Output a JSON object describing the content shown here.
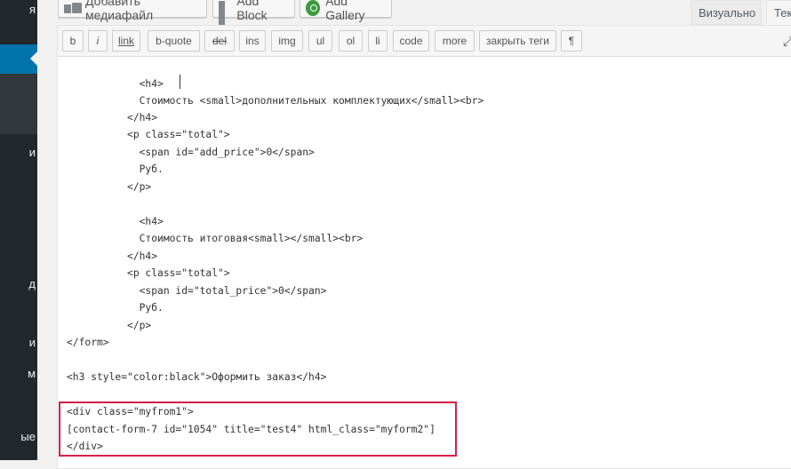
{
  "sidebar": {
    "fragments": [
      "я",
      "и",
      "д",
      "и",
      "м",
      "ые"
    ]
  },
  "media_buttons": {
    "add_media": "Добавить медиафайл",
    "add_block": "Add Block",
    "add_gallery": "Add Gallery",
    "icons": [
      "media-icon",
      "block-icon",
      "gallery-icon"
    ]
  },
  "editor_tabs": {
    "visual": "Визуально",
    "text": "Текст"
  },
  "toolbar": {
    "b": "b",
    "i": "i",
    "link": "link",
    "bquote": "b-quote",
    "del": "del",
    "ins": "ins",
    "img": "img",
    "ul": "ul",
    "ol": "ol",
    "li": "li",
    "code": "code",
    "more": "more",
    "close_tags": "закрыть теги",
    "para": "¶"
  },
  "code_lines": [
    "            <h4>",
    "            Стоимость <small>дополнительных комплектующих</small><br>",
    "          </h4>",
    "          <p class=\"total\">",
    "            <span id=\"add_price\">0</span>",
    "            Руб.",
    "          </p>",
    "",
    "            <h4>",
    "            Стоимость итоговая<small></small><br>",
    "          </h4>",
    "          <p class=\"total\">",
    "            <span id=\"total_price\">0</span>",
    "            Руб.",
    "          </p>",
    "</form>",
    "",
    "<h3 style=\"color:black\">Оформить заказ</h4>",
    "",
    "<div class=\"myfrom1\">",
    "[contact-form-7 id=\"1054\" title=\"test4\" html_class=\"myform2\"]",
    "</div>"
  ],
  "colors": {
    "accent": "#0073aa",
    "sidebar_bg": "#23282d",
    "highlight_border": "#d81f47"
  }
}
